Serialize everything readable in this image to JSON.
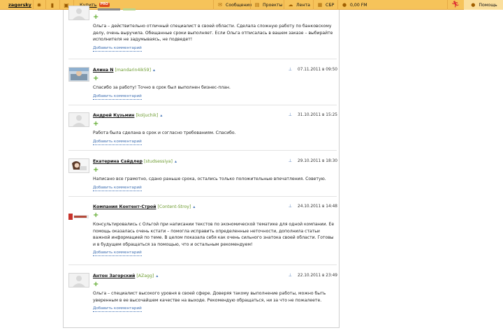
{
  "topbar": {
    "username": "zagorsky",
    "buy_label": "Купить",
    "buy_badge": "PRO",
    "nav": [
      {
        "label": "Сообщения",
        "icon": "envelope-icon"
      },
      {
        "label": "Проекты",
        "icon": "folder-icon"
      },
      {
        "label": "Лента",
        "icon": "feed-icon"
      },
      {
        "label": "СБР",
        "icon": "safe-deal-icon"
      },
      {
        "label": "0,00 FM",
        "icon": "money-icon"
      }
    ],
    "help_label": "Помощь"
  },
  "comments": [
    {
      "name": "",
      "login": "",
      "date": "",
      "text": "Ольга – действительно отличный специалист в своей области. Сделала сложную работу по банковскому делу, очень выручила. Обещанные сроки выполняет. Если Ольга отписалась в вашем заказе – выбирайте исполнителя не задумываясь, не подведет!",
      "add_label": "Добавить комментарий"
    },
    {
      "name": "Алина N",
      "login": "[mandarin4ik59]",
      "date": "07.11.2011 в 09:50",
      "text": "Спасибо за работу! Точно в срок был выполнен бизнес-план.",
      "add_label": "Добавить комментарий"
    },
    {
      "name": "Андрей Кузьмин",
      "login": "[koljuchik]",
      "date": "31.10.2011 в 15:25",
      "text": "Работа была сделана в срок и согласно требованиям. Спасибо.",
      "add_label": "Добавить комментарий"
    },
    {
      "name": "Екатерина Сайдлер",
      "login": "[studsessiya]",
      "date": "29.10.2011 в 18:30",
      "text": "Написано все грамотно, сдано раньше срока, остались только положительные впечатления. Советую.",
      "add_label": "Добавить комментарий"
    },
    {
      "name": "Компания Контент-Строй",
      "login": "[Content-Stroy]",
      "date": "24.10.2011 в 14:48",
      "text": "Консультировались с Ольгой при написании текстов по экономической тематике для одной компании. Ее помощь оказалась очень кстати – помогла исправить определенные неточности, дополнила статьи важной информацией по теме. В целом показала себя как очень сильного знатока своей области. Готовы и в будущем обращаться за помощью, что и остальным рекомендуем!",
      "add_label": "Добавить комментарий"
    },
    {
      "name": "Антон Загорский",
      "login": "[AZagg]",
      "date": "22.10.2011 в 23:49",
      "text": "Ольга – специалист высокого уровня в своей сфере. Доверяя такому выполнение работы, можно быть уверенным в ее высочайшем качестве на выходе. Рекомендую обращаться, ни за что не пожалеете.",
      "add_label": "Добавить комментарий"
    }
  ]
}
